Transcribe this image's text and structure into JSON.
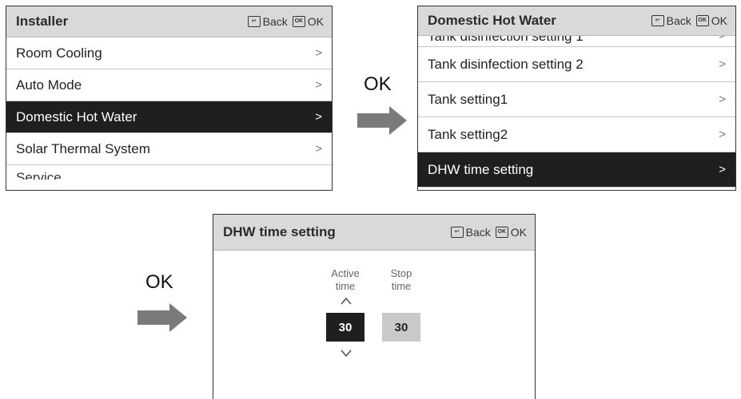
{
  "softkeys": {
    "back": "Back",
    "ok": "OK",
    "ok_icon_text": "OK"
  },
  "flow": {
    "step_label": "OK"
  },
  "screen1": {
    "title": "Installer",
    "items": [
      {
        "label": "Room Cooling",
        "selected": false
      },
      {
        "label": "Auto Mode",
        "selected": false
      },
      {
        "label": "Domestic Hot Water",
        "selected": true
      },
      {
        "label": "Solar Thermal System",
        "selected": false
      }
    ],
    "partial_next": "Service"
  },
  "screen2": {
    "title": "Domestic Hot Water",
    "partial_prev": "Tank disinfection setting 1",
    "items": [
      {
        "label": "Tank disinfection setting 2",
        "selected": false
      },
      {
        "label": "Tank setting1",
        "selected": false
      },
      {
        "label": "Tank setting2",
        "selected": false
      },
      {
        "label": "DHW time setting",
        "selected": true
      }
    ]
  },
  "screen3": {
    "title": "DHW time setting",
    "active_label_1": "Active",
    "active_label_2": "time",
    "stop_label_1": "Stop",
    "stop_label_2": "time",
    "active_value": "30",
    "stop_value": "30"
  },
  "icons": {
    "chevron": "chevron-right-icon",
    "back": "back-icon",
    "ok": "ok-icon",
    "up": "chevron-up-icon",
    "down": "chevron-down-icon",
    "arrow": "arrow-right-icon"
  },
  "colors": {
    "header_bg": "#d9d9d9",
    "selected_bg": "#1f1f1f",
    "stop_box_bg": "#c9c9c9",
    "arrow": "#7a7a7a"
  }
}
